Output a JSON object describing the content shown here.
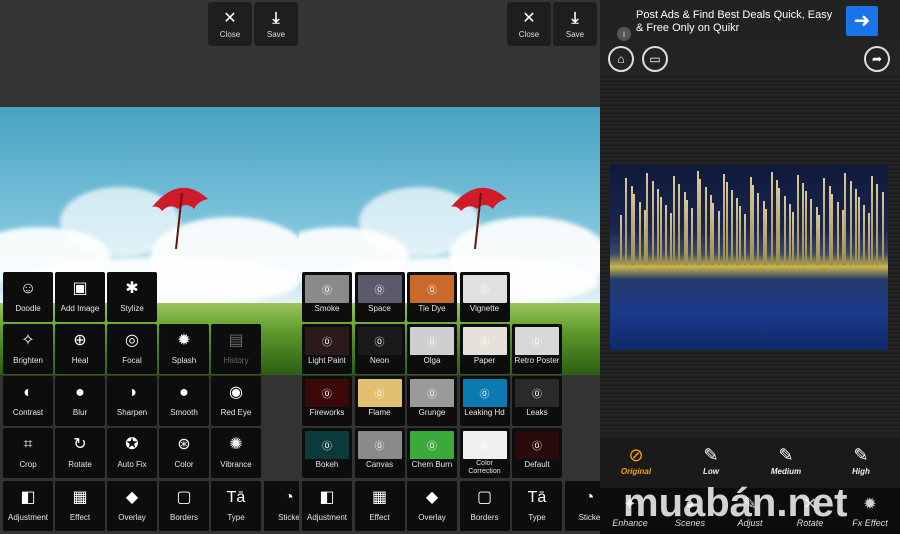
{
  "panel_left": {
    "top_buttons": [
      {
        "icon": "close-icon",
        "label": "Close"
      },
      {
        "icon": "save-icon",
        "label": "Save"
      }
    ],
    "tools": [
      {
        "label": "Doodle",
        "icon": "☺"
      },
      {
        "label": "Add Image",
        "icon": "▣"
      },
      {
        "label": "Stylize",
        "icon": "✱"
      },
      {
        "label": "Brighten",
        "icon": "✧"
      },
      {
        "label": "Heal",
        "icon": "⊕"
      },
      {
        "label": "Focal",
        "icon": "◎"
      },
      {
        "label": "Splash",
        "icon": "✹"
      },
      {
        "label": "History",
        "icon": "▤"
      },
      {
        "label": "Contrast",
        "icon": "◐"
      },
      {
        "label": "Blur",
        "icon": "●"
      },
      {
        "label": "Sharpen",
        "icon": "◑"
      },
      {
        "label": "Smooth",
        "icon": "●"
      },
      {
        "label": "Red Eye",
        "icon": "◉"
      },
      {
        "label": "Crop",
        "icon": "⌗"
      },
      {
        "label": "Rotate",
        "icon": "↻"
      },
      {
        "label": "Auto Fix",
        "icon": "✪"
      },
      {
        "label": "Color",
        "icon": "⊛"
      },
      {
        "label": "Vibrance",
        "icon": "✺"
      },
      {
        "label": "Adjustment",
        "icon": "◧"
      },
      {
        "label": "Effect",
        "icon": "▦"
      },
      {
        "label": "Overlay",
        "icon": "◆"
      },
      {
        "label": "Borders",
        "icon": "▢"
      },
      {
        "label": "Type",
        "icon": "Tā"
      },
      {
        "label": "Sticke",
        "icon": "◔"
      }
    ]
  },
  "panel_middle": {
    "top_buttons": [
      {
        "icon": "close-icon",
        "label": "Close"
      },
      {
        "icon": "save-icon",
        "label": "Save"
      }
    ],
    "effects": [
      {
        "label": "Smoke",
        "color": "#8a8a8a"
      },
      {
        "label": "Space",
        "color": "#5a5a6a"
      },
      {
        "label": "Tie Dye",
        "color": "#c96a2a"
      },
      {
        "label": "Vignette",
        "color": "#e0e0e0"
      },
      {
        "label": "Light Paint",
        "color": "#2a1a1a"
      },
      {
        "label": "Neon",
        "color": "#1a1a1a"
      },
      {
        "label": "Olga",
        "color": "#cfcfcf"
      },
      {
        "label": "Paper",
        "color": "#e6e2da"
      },
      {
        "label": "Retro Poster",
        "color": "#d7d7d7"
      },
      {
        "label": "Fireworks",
        "color": "#3a0a0a"
      },
      {
        "label": "Flame",
        "color": "#e0c070"
      },
      {
        "label": "Grunge",
        "color": "#9a9a9a"
      },
      {
        "label": "Leaking Hd",
        "color": "#0a7ab0"
      },
      {
        "label": "Leaks",
        "color": "#2a2a2a"
      },
      {
        "label": "Bokeh",
        "color": "#0a3a3a"
      },
      {
        "label": "Canvas",
        "color": "#8a8a8a"
      },
      {
        "label": "Chem Burn",
        "color": "#3aaa3a"
      },
      {
        "label": "Color Correction",
        "color": "#f0f0f0"
      },
      {
        "label": "Default",
        "color": "#2a0a0a"
      }
    ],
    "tools": [
      {
        "label": "Adjustment",
        "icon": "◧"
      },
      {
        "label": "Effect",
        "icon": "▦"
      },
      {
        "label": "Overlay",
        "icon": "◆"
      },
      {
        "label": "Borders",
        "icon": "▢"
      },
      {
        "label": "Type",
        "icon": "Tā"
      },
      {
        "label": "Sticke",
        "icon": "◔"
      }
    ]
  },
  "panel_right": {
    "ad": {
      "text": "Post Ads & Find Best Deals Quick, Easy & Free Only on Quikr",
      "info": "i"
    },
    "toolbar": [
      {
        "icon": "home-icon",
        "glyph": "⌂"
      },
      {
        "icon": "folder-icon",
        "glyph": "▭"
      },
      {
        "icon": "share-icon",
        "glyph": "➦"
      }
    ],
    "levels": [
      {
        "label": "Original",
        "icon": "⊘"
      },
      {
        "label": "Low",
        "icon": "✎"
      },
      {
        "label": "Medium",
        "icon": "✎"
      },
      {
        "label": "High",
        "icon": "✎"
      }
    ],
    "modes": [
      {
        "label": "Enhance",
        "icon": "✦"
      },
      {
        "label": "Scenes",
        "icon": "●"
      },
      {
        "label": "Adjust",
        "icon": "✎"
      },
      {
        "label": "Rotate",
        "icon": "✕"
      },
      {
        "label": "Fx Effect",
        "icon": "✹"
      }
    ],
    "accent_color": "#f5a400"
  },
  "watermark": {
    "text": "muabán.net"
  }
}
